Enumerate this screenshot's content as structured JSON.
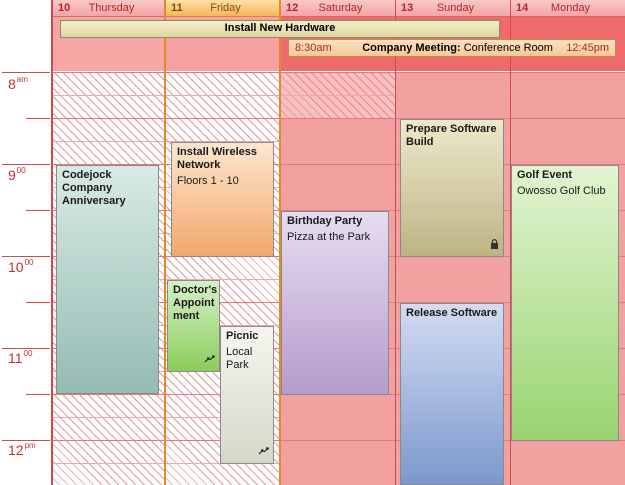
{
  "days": [
    {
      "num": "10",
      "name": "Thursday"
    },
    {
      "num": "11",
      "name": "Friday"
    },
    {
      "num": "12",
      "name": "Saturday"
    },
    {
      "num": "13",
      "name": "Sunday"
    },
    {
      "num": "14",
      "name": "Monday"
    }
  ],
  "hours": [
    {
      "num": "8",
      "suffix": "am"
    },
    {
      "num": "9",
      "suffix": "00"
    },
    {
      "num": "10",
      "suffix": "00"
    },
    {
      "num": "11",
      "suffix": "00"
    },
    {
      "num": "12",
      "suffix": "pm"
    }
  ],
  "allday": {
    "banner": "Install New Hardware",
    "meeting": {
      "start": "8:30am",
      "title": "Company Meeting:",
      "location": "Conference Room",
      "end": "12:45pm"
    }
  },
  "events": {
    "codejock": {
      "title": "Codejock Company Anniversary",
      "sub": ""
    },
    "wireless": {
      "title": "Install Wireless Network",
      "sub": "Floors 1 - 10"
    },
    "doctor": {
      "title": "Doctor's Appoint ment",
      "sub": ""
    },
    "picnic": {
      "title": "Picnic",
      "sub": "Local Park"
    },
    "birthday": {
      "title": "Birthday Party",
      "sub": "Pizza at the Park"
    },
    "prepare": {
      "title": "Prepare Software Build",
      "sub": ""
    },
    "release": {
      "title": "Release Software",
      "sub": ""
    },
    "golf": {
      "title": "Golf Event",
      "sub": "Owosso Golf Club"
    }
  },
  "icons": {
    "recurring": "recurring-icon",
    "lock": "lock-icon"
  },
  "colors": {
    "accent": "#cf4a4a",
    "today": "#f5b55a",
    "weekend": "#ef6a6a"
  }
}
